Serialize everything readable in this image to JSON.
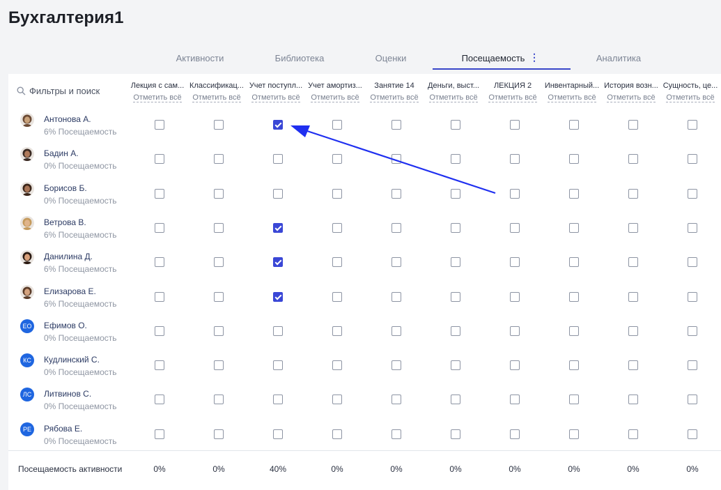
{
  "app": {
    "title": "Бухгалтерия1"
  },
  "tabs": [
    {
      "label": "Активности",
      "active": false
    },
    {
      "label": "Библиотека",
      "active": false
    },
    {
      "label": "Оценки",
      "active": false
    },
    {
      "label": "Посещаемость",
      "active": true
    },
    {
      "label": "Аналитика",
      "active": false
    }
  ],
  "tab_more_icon": "vertical-dots-icon",
  "search": {
    "label": "Фильтры и поиск",
    "icon": "search-icon"
  },
  "mark_all_label": "Отметить всё",
  "columns": [
    {
      "title": "Лекция с сам..."
    },
    {
      "title": "Классификац..."
    },
    {
      "title": "Учет поступл..."
    },
    {
      "title": "Учет амортиз..."
    },
    {
      "title": "Занятие 14"
    },
    {
      "title": "Деньги, выст..."
    },
    {
      "title": "ЛЕКЦИЯ 2"
    },
    {
      "title": "Инвентарный..."
    },
    {
      "title": "История возн..."
    },
    {
      "title": "Сущность, це..."
    }
  ],
  "students": [
    {
      "name": "Антонова А.",
      "attendance": "6% Посещаемость",
      "avatar": "photo",
      "checked": [
        false,
        false,
        true,
        false,
        false,
        false,
        false,
        false,
        false,
        false
      ]
    },
    {
      "name": "Бадин А.",
      "attendance": "0% Посещаемость",
      "avatar": "photo",
      "checked": [
        false,
        false,
        false,
        false,
        false,
        false,
        false,
        false,
        false,
        false
      ]
    },
    {
      "name": "Борисов Б.",
      "attendance": "0% Посещаемость",
      "avatar": "photo",
      "checked": [
        false,
        false,
        false,
        false,
        false,
        false,
        false,
        false,
        false,
        false
      ]
    },
    {
      "name": "Ветрова В.",
      "attendance": "6% Посещаемость",
      "avatar": "photo",
      "checked": [
        false,
        false,
        true,
        false,
        false,
        false,
        false,
        false,
        false,
        false
      ]
    },
    {
      "name": "Данилина Д.",
      "attendance": "6% Посещаемость",
      "avatar": "photo",
      "checked": [
        false,
        false,
        true,
        false,
        false,
        false,
        false,
        false,
        false,
        false
      ]
    },
    {
      "name": "Елизарова Е.",
      "attendance": "6% Посещаемость",
      "avatar": "photo",
      "checked": [
        false,
        false,
        true,
        false,
        false,
        false,
        false,
        false,
        false,
        false
      ]
    },
    {
      "name": "Ефимов О.",
      "attendance": "0% Посещаемость",
      "avatar": "initials",
      "initials": "ЕО",
      "checked": [
        false,
        false,
        false,
        false,
        false,
        false,
        false,
        false,
        false,
        false
      ]
    },
    {
      "name": "Кудлинский С.",
      "attendance": "0% Посещаемость",
      "avatar": "initials",
      "initials": "КС",
      "checked": [
        false,
        false,
        false,
        false,
        false,
        false,
        false,
        false,
        false,
        false
      ]
    },
    {
      "name": "Литвинов С.",
      "attendance": "0% Посещаемость",
      "avatar": "initials",
      "initials": "ЛС",
      "checked": [
        false,
        false,
        false,
        false,
        false,
        false,
        false,
        false,
        false,
        false
      ]
    },
    {
      "name": "Рябова Е.",
      "attendance": "0% Посещаемость",
      "avatar": "initials",
      "initials": "РЕ",
      "checked": [
        false,
        false,
        false,
        false,
        false,
        false,
        false,
        false,
        false,
        false
      ]
    }
  ],
  "footer": {
    "label": "Посещаемость активности",
    "values": [
      "0%",
      "0%",
      "40%",
      "0%",
      "0%",
      "0%",
      "0%",
      "0%",
      "0%",
      "0%"
    ]
  },
  "colors": {
    "accent": "#3a47d6",
    "avatar_initials_bg": "#1f66e0",
    "annotation_arrow": "#1f2ff0"
  },
  "annotation": {
    "icon": "arrow-annotation",
    "points_to": "Антонова А. — Учет поступл..."
  }
}
